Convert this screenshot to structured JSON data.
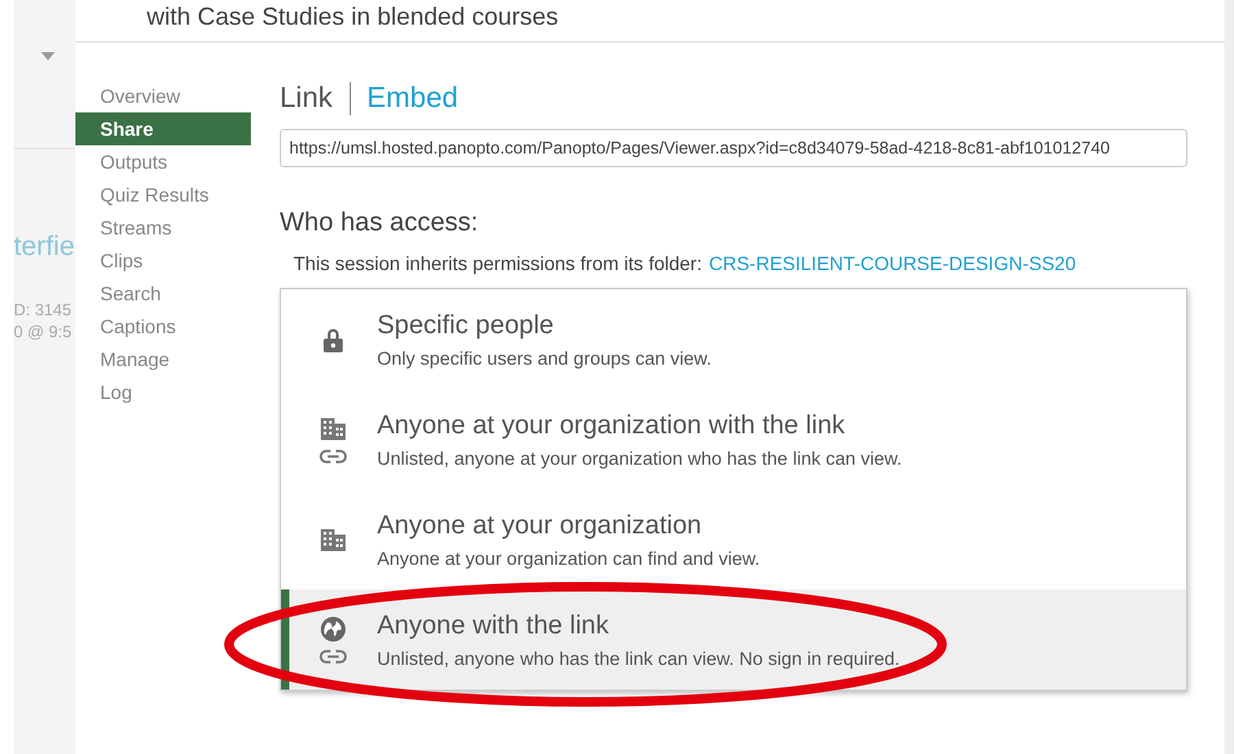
{
  "background": {
    "texts": [
      "terfie",
      "D: 3145",
      "0 @ 9:5"
    ]
  },
  "dialog": {
    "title": "with Case Studies in blended courses",
    "nav": [
      {
        "label": "Overview",
        "selected": false
      },
      {
        "label": "Share",
        "selected": true
      },
      {
        "label": "Outputs",
        "selected": false
      },
      {
        "label": "Quiz Results",
        "selected": false
      },
      {
        "label": "Streams",
        "selected": false
      },
      {
        "label": "Clips",
        "selected": false
      },
      {
        "label": "Search",
        "selected": false
      },
      {
        "label": "Captions",
        "selected": false
      },
      {
        "label": "Manage",
        "selected": false
      },
      {
        "label": "Log",
        "selected": false
      }
    ],
    "tabs": [
      {
        "label": "Link",
        "selected": true
      },
      {
        "label": "Embed",
        "selected": false
      }
    ],
    "url": "https://umsl.hosted.panopto.com/Panopto/Pages/Viewer.aspx?id=c8d34079-58ad-4218-8c81-abf101012740",
    "access_heading": "Who has access:",
    "inherit_text": "This session inherits permissions from its folder:",
    "folder_link": "CRS-RESILIENT-COURSE-DESIGN-SS20",
    "options": [
      {
        "kind": "specific",
        "title": "Specific people",
        "description": "Only specific users and groups can view.",
        "selected": false
      },
      {
        "kind": "org_link",
        "title": "Anyone at your organization with the link",
        "description": "Unlisted, anyone at your organization who has the link can view.",
        "selected": false
      },
      {
        "kind": "org",
        "title": "Anyone at your organization",
        "description": "Anyone at your organization can find and view.",
        "selected": false
      },
      {
        "kind": "public_link",
        "title": "Anyone with the link",
        "description": "Unlisted, anyone who has the link can view. No sign in required.",
        "selected": true
      }
    ]
  }
}
